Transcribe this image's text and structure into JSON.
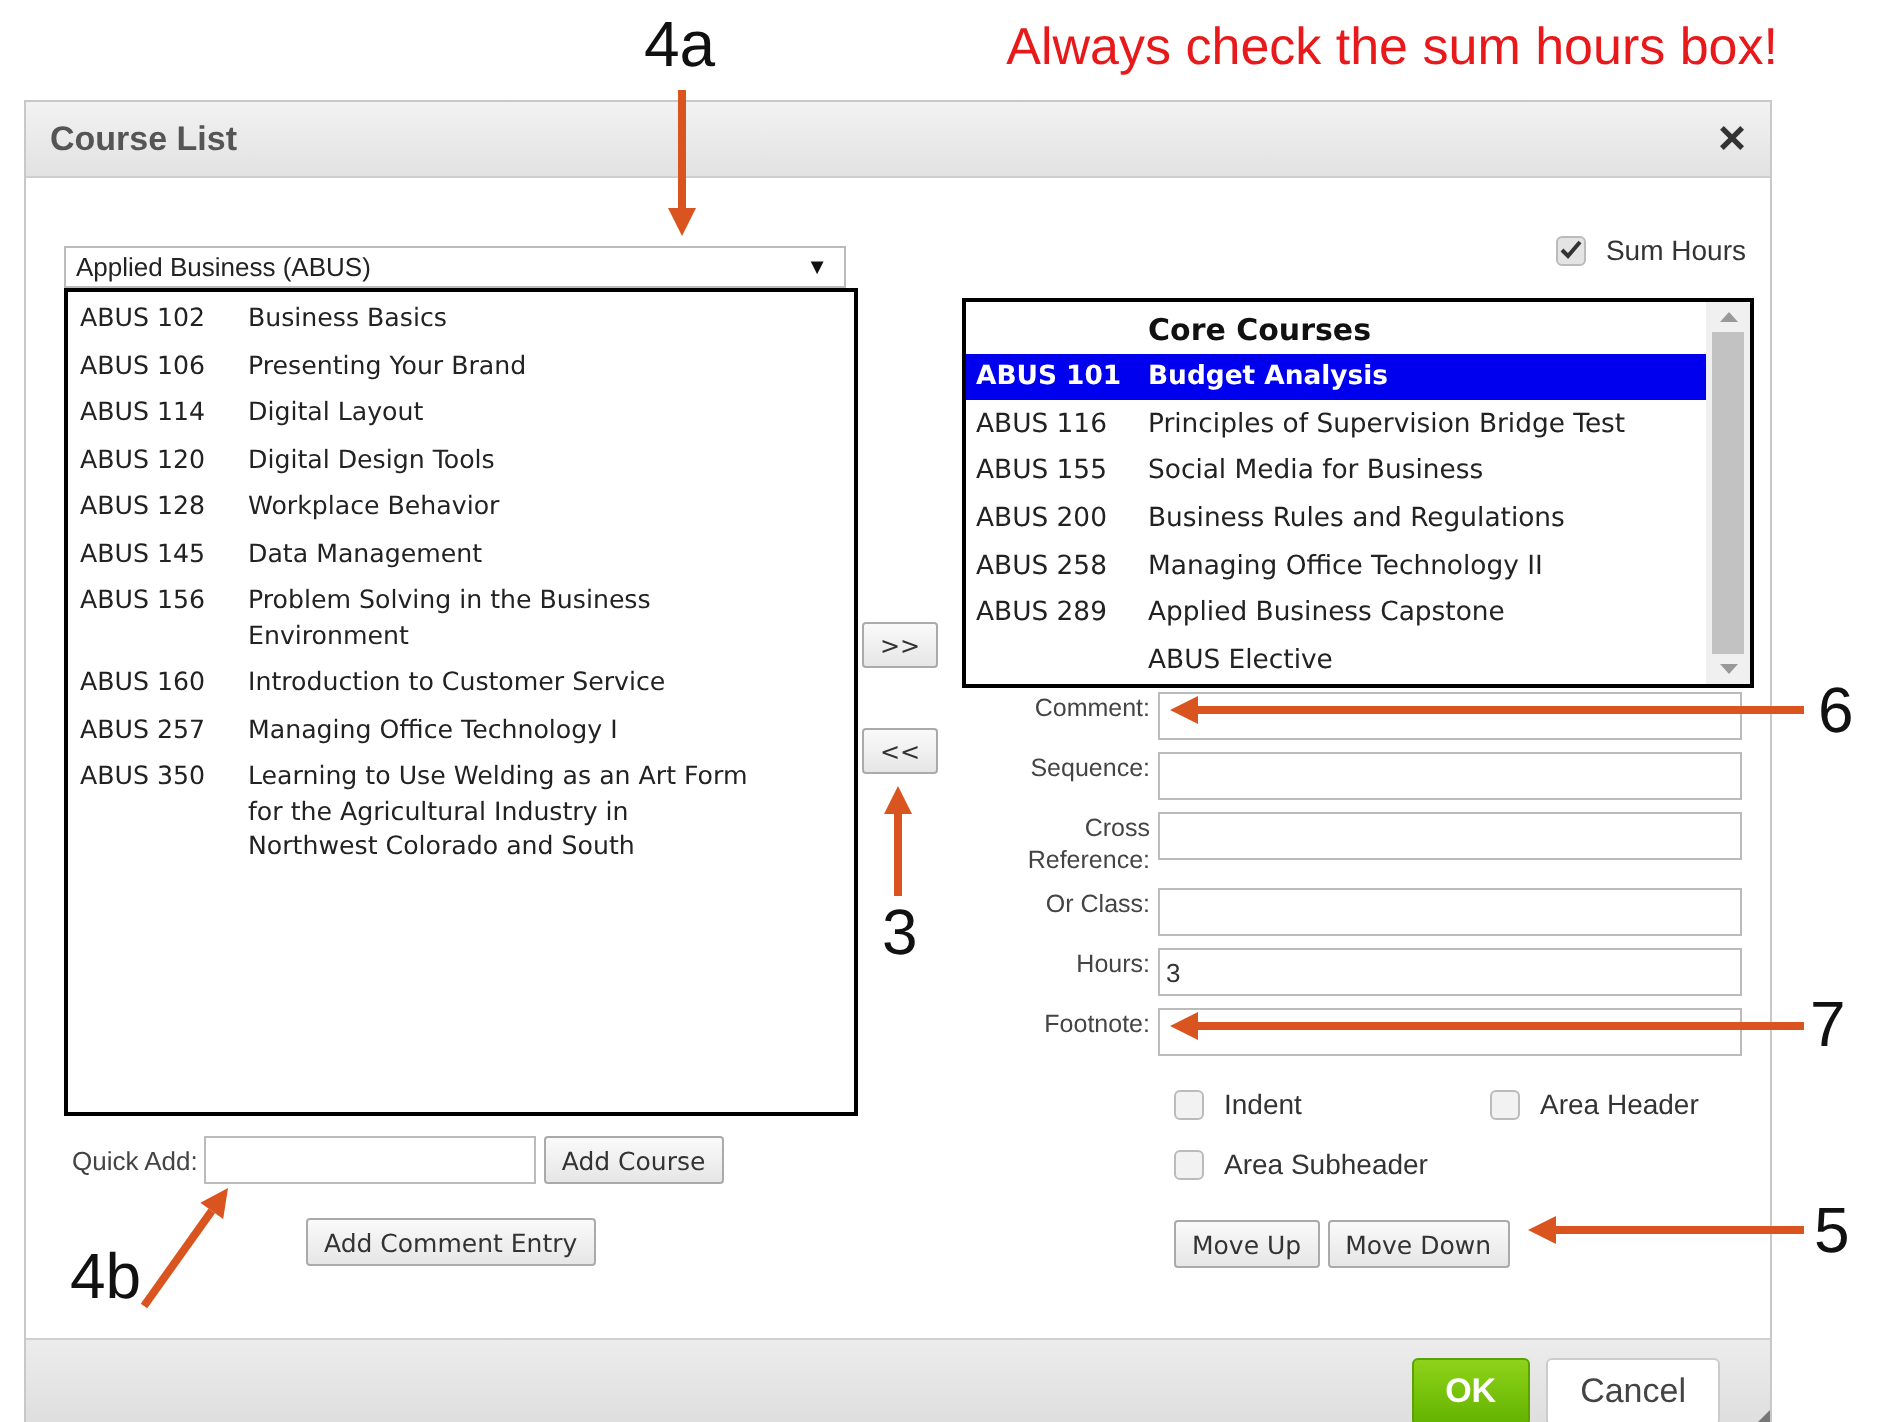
{
  "note": "Always check the sum hours box!",
  "window": {
    "title": "Course List",
    "close": "×"
  },
  "subject_select": {
    "value": "Applied Business (ABUS)",
    "caret": "▼"
  },
  "available_courses": [
    {
      "code": "ABUS 102",
      "name": "Business Basics",
      "selected": false
    },
    {
      "code": "ABUS 106",
      "name": "Presenting Your Brand",
      "selected": false
    },
    {
      "code": "ABUS 114",
      "name": "Digital Layout",
      "selected": false
    },
    {
      "code": "ABUS 120",
      "name": "Digital Design Tools",
      "selected": false
    },
    {
      "code": "ABUS 128",
      "name": "Workplace Behavior",
      "selected": false
    },
    {
      "code": "ABUS 145",
      "name": "Data Management",
      "selected": false
    },
    {
      "code": "ABUS 156",
      "name": "Problem Solving in the Business Environment",
      "selected": false
    },
    {
      "code": "ABUS 160",
      "name": "Introduction to Customer Service",
      "selected": false
    },
    {
      "code": "ABUS 257",
      "name": "Managing Office Technology I",
      "selected": false
    },
    {
      "code": "ABUS 350",
      "name": "Learning to Use Welding as an Art Form for the Agricultural Industry in Northwest Colorado and South",
      "selected": false
    }
  ],
  "move_buttons": [
    ">>",
    "<<"
  ],
  "sum_hours": {
    "label": "Sum Hours",
    "checked": true
  },
  "program_courses": [
    {
      "kind": "header",
      "name": "Core Courses",
      "selected": false
    },
    {
      "kind": "course",
      "code": "ABUS 101",
      "name": "Budget Analysis",
      "selected": true
    },
    {
      "kind": "course",
      "code": "ABUS 116",
      "name": "Principles of Supervision Bridge Test",
      "selected": false
    },
    {
      "kind": "course",
      "code": "ABUS 155",
      "name": "Social Media for Business",
      "selected": false
    },
    {
      "kind": "course",
      "code": "ABUS 200",
      "name": "Business Rules and Regulations",
      "selected": false
    },
    {
      "kind": "course",
      "code": "ABUS 258",
      "name": "Managing Office Technology II",
      "selected": false
    },
    {
      "kind": "course",
      "code": "ABUS 289",
      "name": "Applied Business Capstone",
      "selected": false
    },
    {
      "kind": "course",
      "name": "ABUS Elective",
      "selected": false
    }
  ],
  "fields": [
    {
      "label": "Comment:"
    },
    {
      "label": "Sequence:"
    },
    {
      "label": "Cross Reference:"
    },
    {
      "label": "Or Class:"
    },
    {
      "label": "Hours:",
      "value": "3"
    },
    {
      "label": "Footnote:"
    }
  ],
  "options": [
    {
      "label": "Indent",
      "checked": false
    },
    {
      "label": "Area Header",
      "checked": false
    },
    {
      "label": "Area Subheader",
      "checked": false
    }
  ],
  "order_buttons": [
    "Move Up",
    "Move Down"
  ],
  "quick_add": {
    "label": "Quick Add:",
    "button": "Add Course"
  },
  "add_comment_button": "Add Comment Entry",
  "footer_buttons": [
    {
      "label": "OK",
      "kind": "primary"
    },
    {
      "label": "Cancel",
      "kind": "secondary"
    }
  ],
  "callouts": [
    {
      "label": "4a"
    },
    {
      "label": "6"
    },
    {
      "label": "3"
    },
    {
      "label": "7"
    },
    {
      "label": "5"
    },
    {
      "label": "4b"
    }
  ]
}
